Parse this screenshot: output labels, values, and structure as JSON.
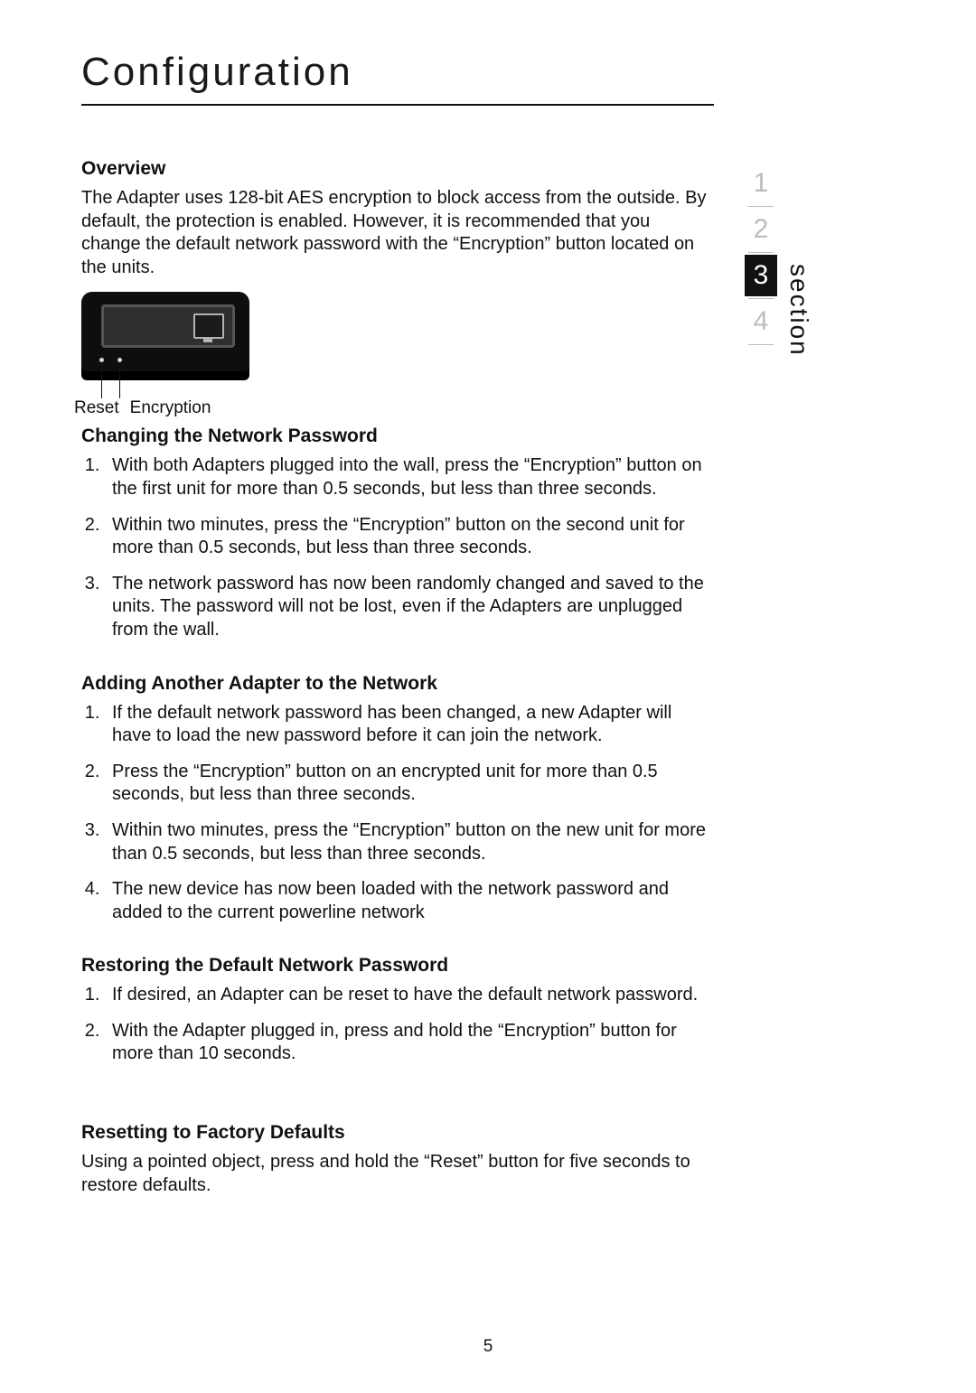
{
  "page_title": "Configuration",
  "page_number": "5",
  "nav": {
    "label": "section",
    "items": [
      "1",
      "2",
      "3",
      "4"
    ],
    "active_index": 2
  },
  "figure": {
    "label_reset": "Reset",
    "label_encryption": "Encryption"
  },
  "sections": [
    {
      "heading": "Overview",
      "paragraph": "The Adapter uses 128-bit AES encryption to block access from the outside. By default, the protection is enabled. However, it is recommended that you change the default network password with the “Encryption” button located on the units."
    },
    {
      "heading": "Changing the Network Password",
      "list": [
        "With both Adapters plugged into the wall, press the “Encryption” button on the first unit for more than 0.5 seconds, but less than three seconds.",
        "Within two minutes, press the “Encryption” button on the second unit for more than 0.5 seconds, but less than three seconds.",
        "The network password has now been randomly changed and saved to the units. The password will not be lost, even if the Adapters are unplugged from the wall."
      ]
    },
    {
      "heading": "Adding Another Adapter to the Network",
      "list": [
        "If the default network password has been changed, a new Adapter will have to load the new password before it can join the network.",
        "Press the “Encryption” button on an encrypted unit for more than 0.5 seconds, but less than three seconds.",
        "Within two minutes, press the “Encryption” button on the new unit for more than 0.5 seconds, but less than three seconds.",
        "The new device has now been loaded with the network password and added to the current powerline network"
      ]
    },
    {
      "heading": "Restoring the Default Network Password",
      "list": [
        "If desired, an Adapter can be reset to have the default network password.",
        "With the Adapter plugged in, press and hold the “Encryption” button for more than 10 seconds."
      ]
    },
    {
      "heading": "Resetting to Factory Defaults",
      "paragraph": "Using a pointed object, press and hold the “Reset” button for five seconds to restore defaults."
    }
  ]
}
